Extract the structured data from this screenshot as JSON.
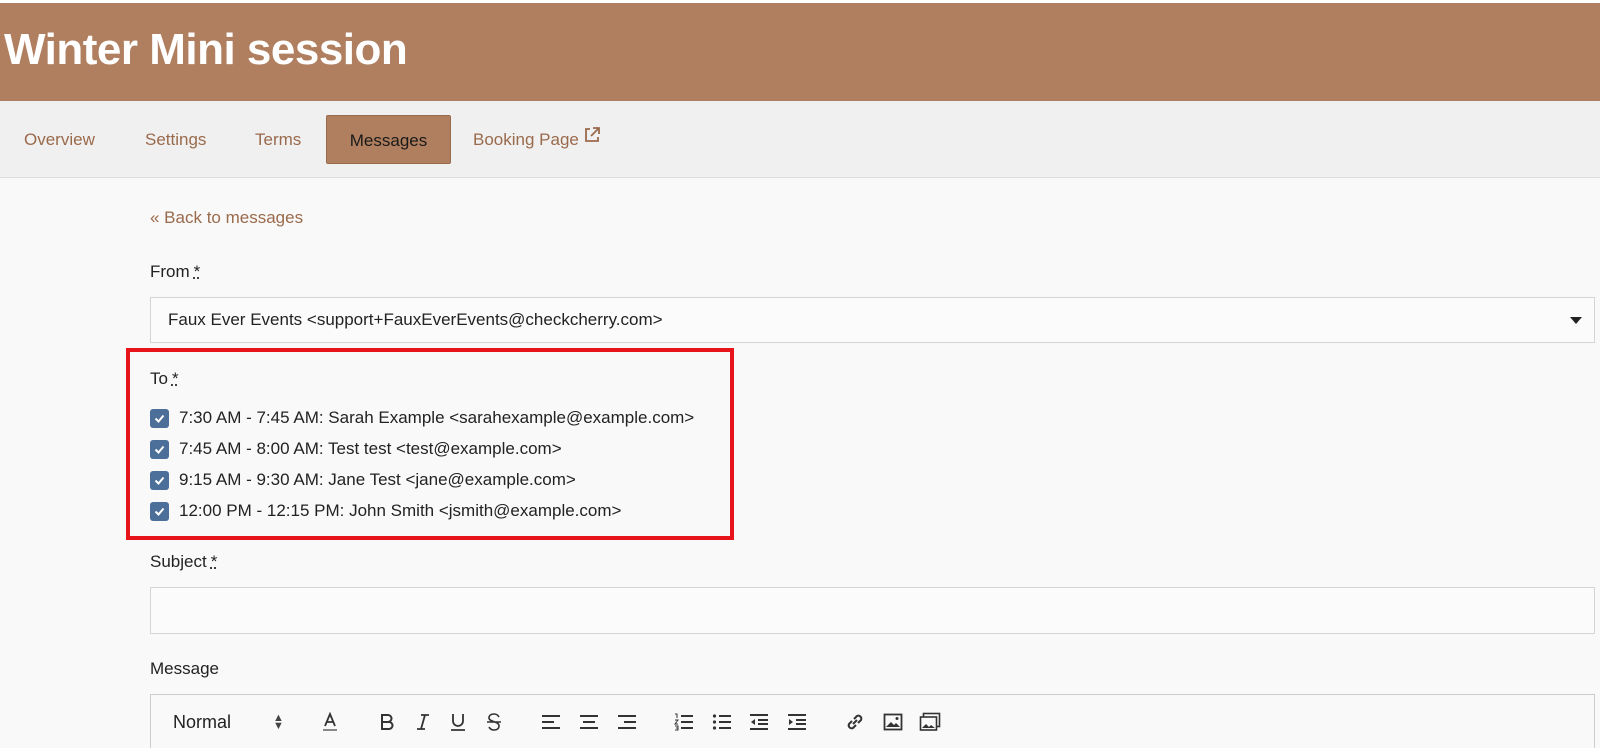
{
  "header": {
    "title": "Winter Mini session",
    "bg_color": "#b07f5f"
  },
  "tabs": [
    {
      "label": "Overview",
      "active": false
    },
    {
      "label": "Settings",
      "active": false
    },
    {
      "label": "Terms",
      "active": false
    },
    {
      "label": "Messages",
      "active": true
    },
    {
      "label": "Booking Page",
      "active": false,
      "icon": "external-link-icon"
    }
  ],
  "back_link": "« Back to messages",
  "form": {
    "from_label": "From",
    "from_value": "Faux Ever Events <support+FauxEverEvents@checkcherry.com>",
    "to_label": "To",
    "required_mark": "*",
    "recipients": [
      {
        "label": "7:30 AM - 7:45 AM: Sarah Example <sarahexample@example.com>",
        "checked": true
      },
      {
        "label": "7:45 AM - 8:00 AM: Test test <test@example.com>",
        "checked": true
      },
      {
        "label": "9:15 AM - 9:30 AM: Jane Test <jane@example.com>",
        "checked": true
      },
      {
        "label": "12:00 PM - 12:15 PM: John Smith <jsmith@example.com>",
        "checked": true
      }
    ],
    "subject_label": "Subject",
    "subject_value": "",
    "message_label": "Message"
  },
  "toolbar": {
    "format_value": "Normal",
    "icons": [
      "font-color-icon",
      "bold-icon",
      "italic-icon",
      "underline-icon",
      "strikethrough-icon",
      "align-left-icon",
      "align-center-icon",
      "align-right-icon",
      "ordered-list-icon",
      "bullet-list-icon",
      "outdent-icon",
      "indent-icon",
      "link-icon",
      "image-icon",
      "gallery-icon"
    ]
  },
  "colors": {
    "accent": "#b07f5f",
    "link": "#9a6a4c",
    "checkbox": "#4b6f99",
    "highlight": "#e8141b"
  }
}
